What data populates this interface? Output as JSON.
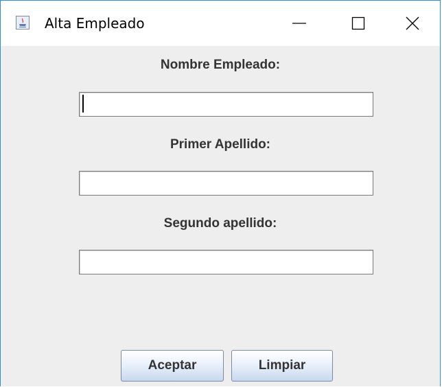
{
  "window": {
    "title": "Alta Empleado",
    "controls": {
      "minimize": "minimize-icon",
      "maximize": "maximize-icon",
      "close": "close-icon"
    }
  },
  "form": {
    "fields": [
      {
        "label": "Nombre Empleado:",
        "value": "",
        "focused": true
      },
      {
        "label": "Primer Apellido:",
        "value": ""
      },
      {
        "label": "Segundo apellido:",
        "value": ""
      }
    ]
  },
  "buttons": {
    "accept_label": "Aceptar",
    "clear_label": "Limpiar"
  },
  "colors": {
    "window_border": "#2b8fd8",
    "client_background": "#eeeeee",
    "label_text": "#333333"
  }
}
